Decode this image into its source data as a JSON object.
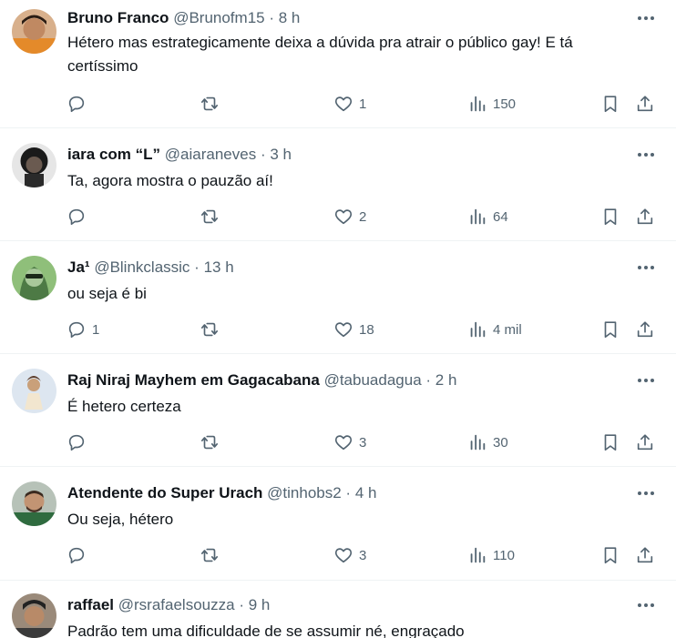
{
  "tweets": [
    {
      "name": "Bruno Franco",
      "handle": "@Brunofm15",
      "dot": "·",
      "time": "8 h",
      "text": "Hétero mas estrategicamente deixa a dúvida pra atrair o público gay! E tá certíssimo",
      "reply_count": "",
      "like_count": "1",
      "view_count": "150",
      "avatar_bg": "#c9a27c"
    },
    {
      "name": "iara com “L”",
      "handle": "@aiaraneves",
      "dot": "·",
      "time": "3 h",
      "text": "Ta, agora mostra o pauzão aí!",
      "reply_count": "",
      "like_count": "2",
      "view_count": "64",
      "avatar_bg": "#d9d9d9"
    },
    {
      "name": "Ja¹",
      "handle": "@Blinkclassic",
      "dot": "·",
      "time": "13 h",
      "text": "ou seja é bi",
      "reply_count": "1",
      "like_count": "18",
      "view_count": "4 mil",
      "avatar_bg": "#6fa36b"
    },
    {
      "name": "Raj Niraj Mayhem em Gagacabana",
      "handle": "@tabuadagua",
      "dot": "·",
      "time": "2 h",
      "text": "É hetero certeza",
      "reply_count": "",
      "like_count": "3",
      "view_count": "30",
      "avatar_bg": "#c8d6e8"
    },
    {
      "name": "Atendente do Super Urach",
      "handle": "@tinhobs2",
      "dot": "·",
      "time": "4 h",
      "text": "Ou seja, hétero",
      "reply_count": "",
      "like_count": "3",
      "view_count": "110",
      "avatar_bg": "#9fb0a0"
    },
    {
      "name": "raffael",
      "handle": "@rsrafaelsouzza",
      "dot": "·",
      "time": "9 h",
      "text": "Padrão tem uma dificuldade de se assumir né, engraçado",
      "avatar_bg": "#8a7a6a"
    }
  ],
  "colors": {
    "text": "#0f1419",
    "secondary": "#536471",
    "border": "#eff3f4",
    "background": "#ffffff"
  },
  "icons": {
    "more": "ellipsis-icon",
    "reply": "speech-bubble-icon",
    "retweet": "retweet-arrows-icon",
    "like": "heart-icon",
    "views": "bar-chart-icon",
    "bookmark": "bookmark-icon",
    "share": "share-upload-icon"
  }
}
